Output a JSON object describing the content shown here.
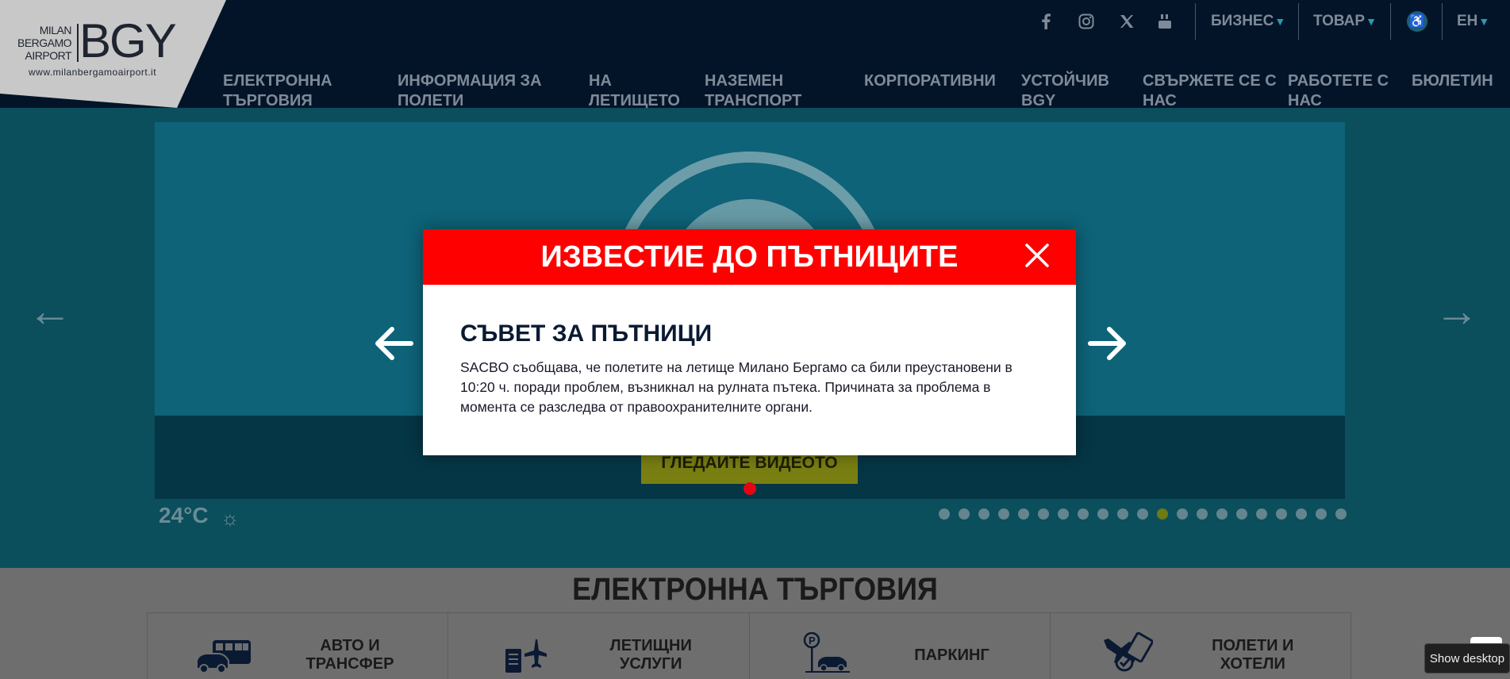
{
  "header": {
    "logo": {
      "small_lines": [
        "MILAN",
        "BERGAMO",
        "AIRPORT"
      ],
      "big": "BGY",
      "url": "www.milanbergamoairport.it"
    },
    "social_icons": [
      "facebook-icon",
      "instagram-icon",
      "x-icon",
      "youtube-icon"
    ],
    "top_links": [
      {
        "label": "БИЗНЕС",
        "caret": "▼"
      },
      {
        "label": "ТОВАР",
        "caret": "▼"
      },
      {
        "label": "ЕН",
        "caret": "▼"
      }
    ],
    "accessibility_icon": "wheelchair-icon",
    "nav": [
      "ЕЛЕКТРОННА ТЪРГОВИЯ",
      "ИНФОРМАЦИЯ ЗА ПОЛЕТИ",
      "НА ЛЕТИЩЕТО",
      "НАЗЕМЕН ТРАНСПОРТ",
      "КОРПОРАТИВНИ",
      "УСТОЙЧИВ BGY",
      "СВЪРЖЕТЕ СЕ С НАС",
      "РАБОТЕТЕ С НАС",
      "БЮЛЕТИН"
    ]
  },
  "hero": {
    "video_button": "ГЛЕДАЙТЕ ВИДЕОТО",
    "temperature": "24°C",
    "weather_icon": "sun-icon",
    "slide_count": 21,
    "active_slide": 12
  },
  "ecommerce": {
    "title": "ЕЛЕКТРОННА ТЪРГОВИЯ",
    "cards": [
      {
        "label": "АВТО И ТРАНСФЕР",
        "icon": "bus-car-icon"
      },
      {
        "label": "ЛЕТИЩНИ УСЛУГИ",
        "icon": "document-plane-icon"
      },
      {
        "label": "ПАРКИНГ",
        "icon": "parking-icon"
      },
      {
        "label": "ПОЛЕТИ И ХОТЕЛИ",
        "icon": "plane-hotel-icon"
      }
    ]
  },
  "modal": {
    "title": "ИЗВЕСТИЕ ДО ПЪТНИЦИТЕ",
    "heading": "СЪВЕТ ЗА ПЪТНИЦИ",
    "body": "SACBO съобщава, че полетите на летище Милано Бергамо са били преустановени в 10:20 ч. поради проблем, възникнал на рулната пътека. Причината за проблема в момента се разследва от правоохранителните органи."
  },
  "taskbar": {
    "show_desktop": "Show desktop"
  },
  "colors": {
    "header_bg": "#041428",
    "modal_header": "#ff0000",
    "hero_bg": "#0b4e5c",
    "accent": "#2a9bb0"
  }
}
